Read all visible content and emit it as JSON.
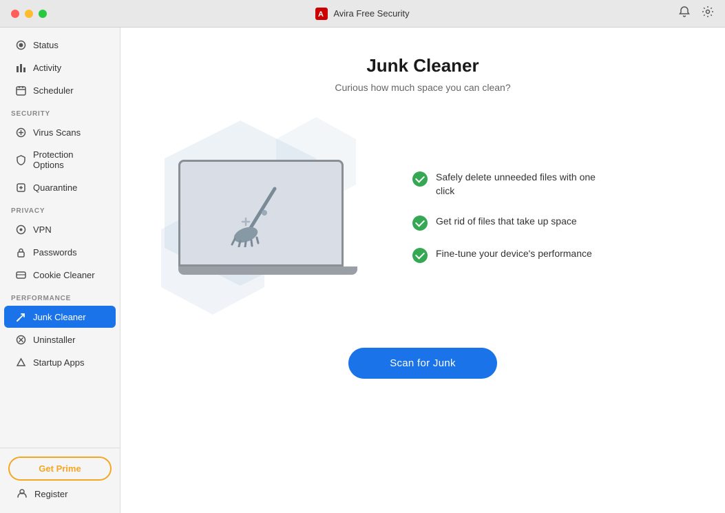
{
  "titlebar": {
    "app_name": "Avira Free Security",
    "icon_label": "A"
  },
  "sidebar": {
    "general": {
      "items": [
        {
          "id": "status",
          "label": "Status",
          "icon": "●"
        },
        {
          "id": "activity",
          "label": "Activity",
          "icon": "▦"
        },
        {
          "id": "scheduler",
          "label": "Scheduler",
          "icon": "☐"
        }
      ]
    },
    "security_label": "SECURITY",
    "security": {
      "items": [
        {
          "id": "virus-scans",
          "label": "Virus Scans",
          "icon": "◎"
        },
        {
          "id": "protection-options",
          "label": "Protection Options",
          "icon": "⬡"
        },
        {
          "id": "quarantine",
          "label": "Quarantine",
          "icon": "☐"
        }
      ]
    },
    "privacy_label": "PRIVACY",
    "privacy": {
      "items": [
        {
          "id": "vpn",
          "label": "VPN",
          "icon": "◉"
        },
        {
          "id": "passwords",
          "label": "Passwords",
          "icon": "🔒"
        },
        {
          "id": "cookie-cleaner",
          "label": "Cookie Cleaner",
          "icon": "☐"
        }
      ]
    },
    "performance_label": "PERFORMANCE",
    "performance": {
      "items": [
        {
          "id": "junk-cleaner",
          "label": "Junk Cleaner",
          "icon": "✦",
          "active": true
        },
        {
          "id": "uninstaller",
          "label": "Uninstaller",
          "icon": "⊗"
        },
        {
          "id": "startup-apps",
          "label": "Startup Apps",
          "icon": "✈"
        }
      ]
    },
    "get_prime_label": "Get Prime",
    "register_label": "Register"
  },
  "main": {
    "title": "Junk Cleaner",
    "subtitle": "Curious how much space you can clean?",
    "features": [
      {
        "text": "Safely delete unneeded files with one click"
      },
      {
        "text": "Get rid of files that take up space"
      },
      {
        "text": "Fine-tune your device's performance"
      }
    ],
    "scan_button_label": "Scan for Junk"
  }
}
